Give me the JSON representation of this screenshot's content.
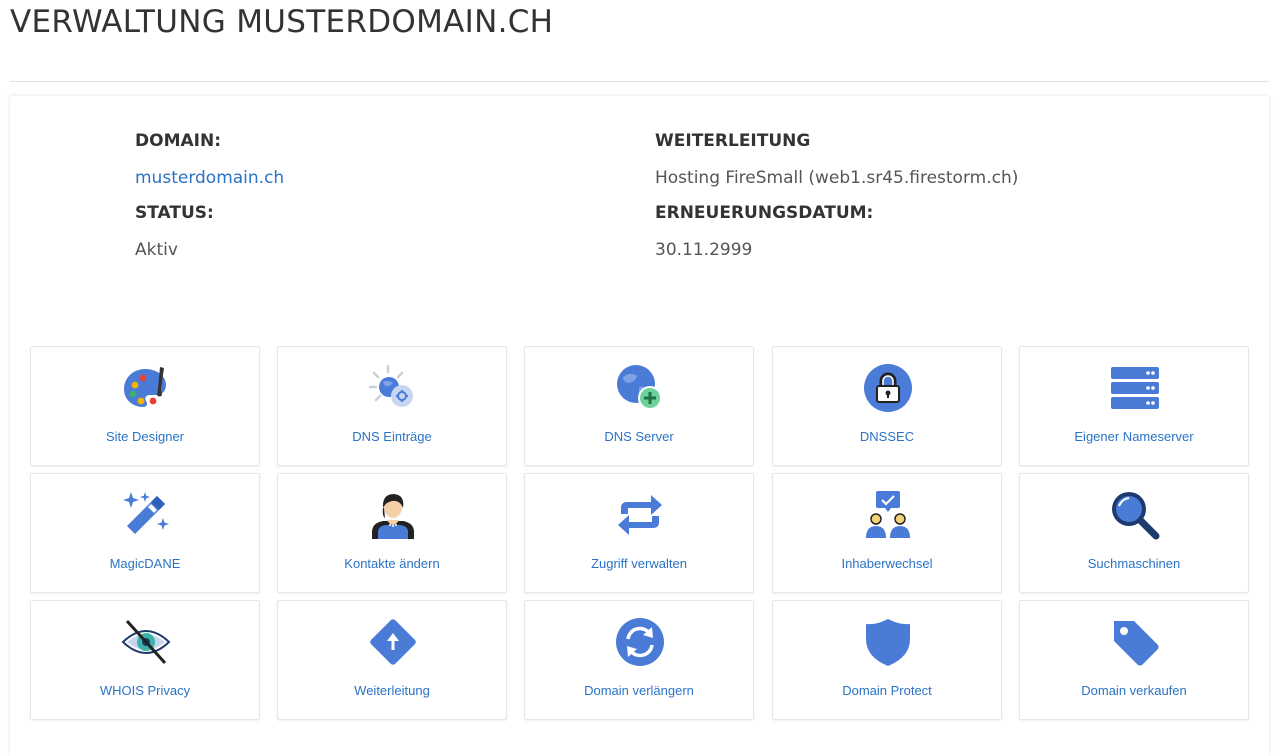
{
  "page": {
    "title": "VERWALTUNG MUSTERDOMAIN.CH"
  },
  "info": {
    "domain_label": "DOMAIN:",
    "domain_value": "musterdomain.ch",
    "status_label": "STATUS:",
    "status_value": "Aktiv",
    "forward_label": "WEITERLEITUNG",
    "forward_value": "Hosting FireSmall (web1.sr45.firestorm.ch)",
    "renewal_label": "ERNEUERUNGSDATUM:",
    "renewal_value": "30.11.2999"
  },
  "tiles": [
    {
      "label": "Site Designer",
      "icon": "palette-icon"
    },
    {
      "label": "DNS Einträge",
      "icon": "globe-gear-icon"
    },
    {
      "label": "DNS Server",
      "icon": "globe-plus-icon"
    },
    {
      "label": "DNSSEC",
      "icon": "lock-icon"
    },
    {
      "label": "Eigener Nameserver",
      "icon": "server-icon"
    },
    {
      "label": "MagicDANE",
      "icon": "magic-wand-icon"
    },
    {
      "label": "Kontakte ändern",
      "icon": "person-icon"
    },
    {
      "label": "Zugriff verwalten",
      "icon": "swap-arrows-icon"
    },
    {
      "label": "Inhaberwechsel",
      "icon": "owners-icon"
    },
    {
      "label": "Suchmaschinen",
      "icon": "magnifier-icon"
    },
    {
      "label": "WHOIS Privacy",
      "icon": "eye-slash-icon"
    },
    {
      "label": "Weiterleitung",
      "icon": "direction-sign-icon"
    },
    {
      "label": "Domain verlängern",
      "icon": "renew-icon"
    },
    {
      "label": "Domain Protect",
      "icon": "shield-icon"
    },
    {
      "label": "Domain verkaufen",
      "icon": "tag-icon"
    }
  ],
  "colors": {
    "accent": "#4a7bd7",
    "link": "#2a73c6",
    "green": "#3bb36a"
  }
}
